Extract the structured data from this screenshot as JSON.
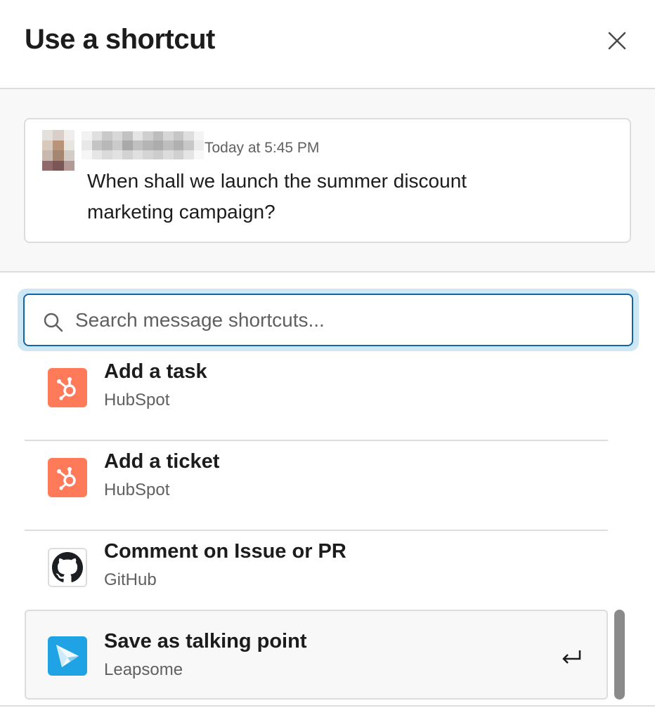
{
  "dialog": {
    "title": "Use a shortcut",
    "close_icon": "close-icon"
  },
  "message": {
    "timestamp": "Today at 5:45 PM",
    "text": "When shall we launch the summer discount marketing campaign?",
    "sender_name_redacted": true
  },
  "search": {
    "placeholder": "Search message shortcuts...",
    "value": "",
    "focus_ring_color": "#1264a3"
  },
  "shortcuts": [
    {
      "title": "Add a task",
      "app": "HubSpot",
      "icon": "hubspot-icon",
      "color": "#ff7a59"
    },
    {
      "title": "Add a ticket",
      "app": "HubSpot",
      "icon": "hubspot-icon",
      "color": "#ff7a59"
    },
    {
      "title": "Comment on Issue or PR",
      "app": "GitHub",
      "icon": "github-icon",
      "color": "#1b1f23"
    },
    {
      "title": "Save as talking point",
      "app": "Leapsome",
      "icon": "leapsome-icon",
      "color": "#1fa3e5",
      "selected": true,
      "shortcut_hint_icon": "enter-key-icon"
    }
  ]
}
